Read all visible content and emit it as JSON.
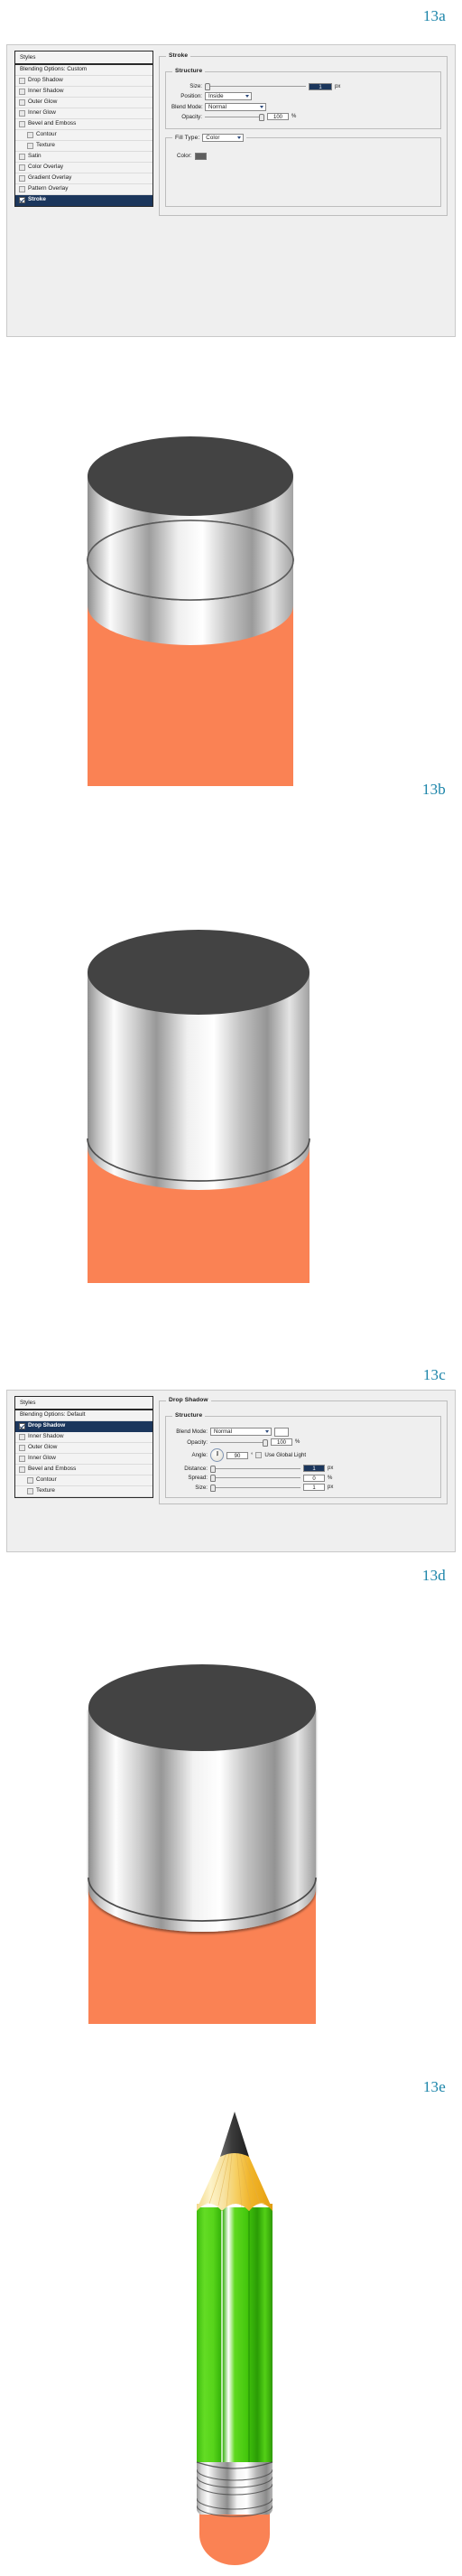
{
  "figures": [
    {
      "id": "13a",
      "label": "13a"
    },
    {
      "id": "13b",
      "label": "13b"
    },
    {
      "id": "13c",
      "label": "13c"
    },
    {
      "id": "13d",
      "label": "13d"
    },
    {
      "id": "13e",
      "label": "13e"
    }
  ],
  "label_color": "#1883a8",
  "dialog_stroke": {
    "styles_panel": {
      "header": "Styles",
      "blending_options": "Blending Options: Custom",
      "items": [
        {
          "label": "Drop Shadow",
          "checked": false,
          "indent": false,
          "selected": false
        },
        {
          "label": "Inner Shadow",
          "checked": false,
          "indent": false,
          "selected": false
        },
        {
          "label": "Outer Glow",
          "checked": false,
          "indent": false,
          "selected": false
        },
        {
          "label": "Inner Glow",
          "checked": false,
          "indent": false,
          "selected": false
        },
        {
          "label": "Bevel and Emboss",
          "checked": false,
          "indent": false,
          "selected": false
        },
        {
          "label": "Contour",
          "checked": false,
          "indent": true,
          "selected": false
        },
        {
          "label": "Texture",
          "checked": false,
          "indent": true,
          "selected": false
        },
        {
          "label": "Satin",
          "checked": false,
          "indent": false,
          "selected": false
        },
        {
          "label": "Color Overlay",
          "checked": false,
          "indent": false,
          "selected": false
        },
        {
          "label": "Gradient Overlay",
          "checked": false,
          "indent": false,
          "selected": false
        },
        {
          "label": "Pattern Overlay",
          "checked": false,
          "indent": false,
          "selected": false
        },
        {
          "label": "Stroke",
          "checked": true,
          "indent": false,
          "selected": true
        }
      ]
    },
    "options": {
      "title": "Stroke",
      "structure_title": "Structure",
      "size_label": "Size:",
      "size_value": "1",
      "size_unit": "px",
      "position_label": "Position:",
      "position_value": "Inside",
      "blend_mode_label": "Blend Mode:",
      "blend_mode_value": "Normal",
      "opacity_label": "Opacity:",
      "opacity_value": "100",
      "opacity_unit": "%",
      "fill_type_label": "Fill Type:",
      "fill_type_value": "Color",
      "color_label": "Color:",
      "color_swatch": "#5e5e5e"
    }
  },
  "dialog_drop_shadow": {
    "styles_panel": {
      "header": "Styles",
      "blending_options": "Blending Options: Default",
      "items": [
        {
          "label": "Drop Shadow",
          "checked": true,
          "indent": false,
          "selected": true
        },
        {
          "label": "Inner Shadow",
          "checked": false,
          "indent": false,
          "selected": false
        },
        {
          "label": "Outer Glow",
          "checked": false,
          "indent": false,
          "selected": false
        },
        {
          "label": "Inner Glow",
          "checked": false,
          "indent": false,
          "selected": false
        },
        {
          "label": "Bevel and Emboss",
          "checked": false,
          "indent": false,
          "selected": false
        },
        {
          "label": "Contour",
          "checked": false,
          "indent": true,
          "selected": false
        },
        {
          "label": "Texture",
          "checked": false,
          "indent": true,
          "selected": false
        }
      ]
    },
    "options": {
      "title": "Drop Shadow",
      "structure_title": "Structure",
      "blend_mode_label": "Blend Mode:",
      "blend_mode_value": "Normal",
      "shadow_color": "#ffffff",
      "opacity_label": "Opacity:",
      "opacity_value": "100",
      "opacity_unit": "%",
      "angle_label": "Angle:",
      "angle_value": "90",
      "angle_unit": "°",
      "use_global_light": "Use Global Light",
      "distance_label": "Distance:",
      "distance_value": "1",
      "distance_unit": "px",
      "spread_label": "Spread:",
      "spread_value": "0",
      "spread_unit": "%",
      "size_label": "Size:",
      "size_value": "1",
      "size_unit": "px"
    }
  },
  "artwork": {
    "cylinder": {
      "top_color": "#434343",
      "body_color": "#fa8254",
      "metal_light": "#ffffff",
      "metal_mid": "#c9c9c9",
      "metal_dark": "#8a8a8a",
      "outline_color": "#555555"
    },
    "pencil": {
      "lead_color": "#3a3a3a",
      "wood_light": "#f6e3a8",
      "wood_mid": "#f3c24a",
      "wood_dark": "#e8a317",
      "barrel_green_light": "#66e026",
      "barrel_green_mid": "#3fc40a",
      "barrel_green_dark": "#1f8a06",
      "ferrule_light": "#ffffff",
      "ferrule_mid": "#b9b9b9",
      "ferrule_dark": "#777777",
      "eraser_color": "#fa8254"
    }
  }
}
